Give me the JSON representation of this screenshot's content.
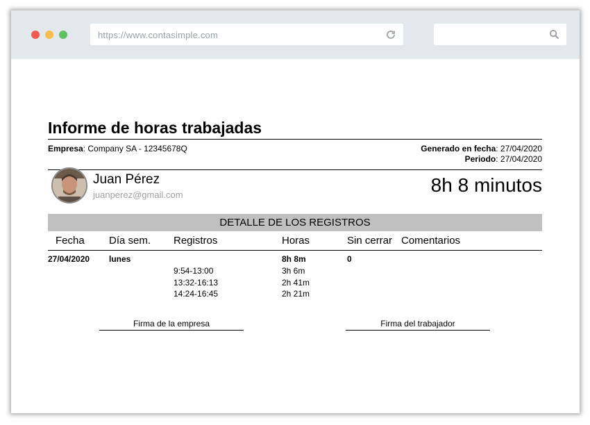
{
  "browser": {
    "url": "https://www.contasimple.com",
    "search_placeholder": ""
  },
  "report": {
    "title": "Informe de horas trabajadas",
    "company_label": "Empresa",
    "company_value": ": Company SA - 12345678Q",
    "generated_label": "Generado en fecha",
    "generated_value": ": 27/04/2020",
    "period_label": "Periodo",
    "period_value": ": 27/04/2020"
  },
  "employee": {
    "name": "Juan Pérez",
    "email": "juanperez@gmail.com",
    "total": "8h  8 minutos"
  },
  "detail": {
    "section_title": "DETALLE DE LOS REGISTROS",
    "headers": [
      "Fecha",
      "Día sem.",
      "Registros",
      "Horas",
      "Sin cerrar",
      "Comentarios"
    ],
    "row": {
      "fecha": "27/04/2020",
      "dia": "lunes",
      "total_horas": "8h 8m",
      "sin_cerrar": "0",
      "registros": [
        "9:54-13:00",
        "13:32-16:13",
        "14:24-16:45"
      ],
      "horas": [
        "3h 6m",
        "2h 41m",
        "2h 21m"
      ]
    }
  },
  "signatures": {
    "company": "Firma de la empresa",
    "worker": "Firma del trabajador"
  }
}
